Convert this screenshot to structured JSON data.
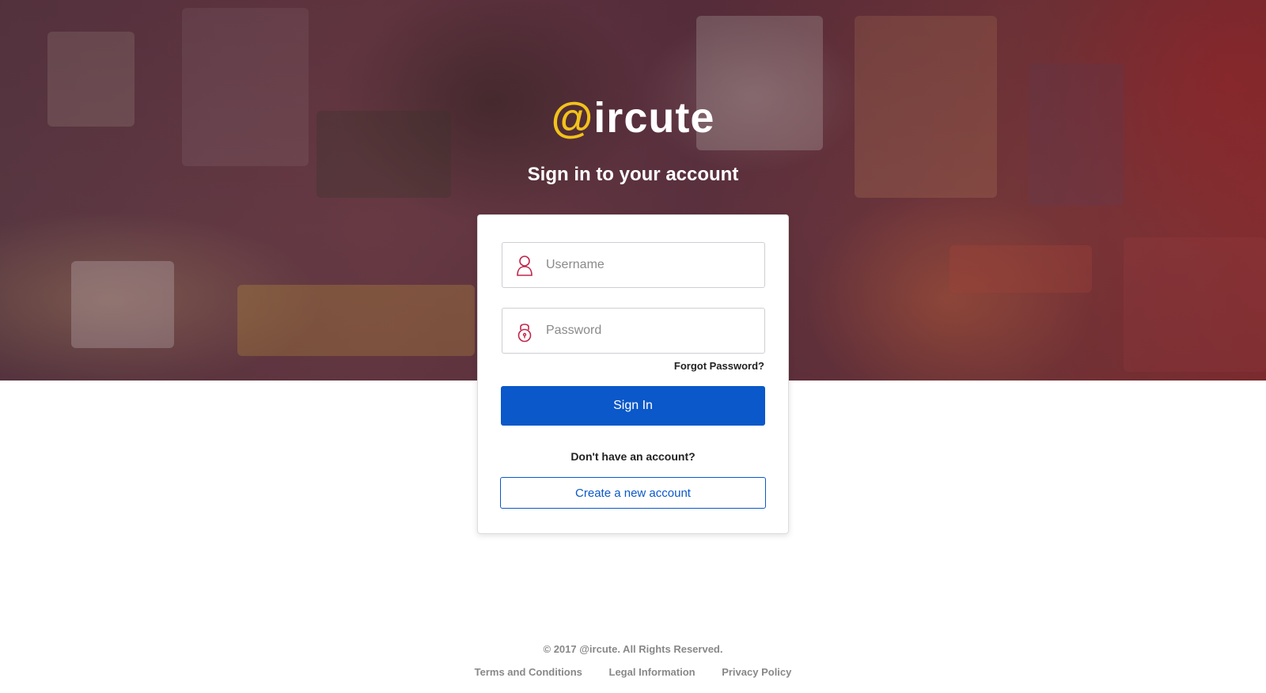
{
  "brand": {
    "logo_at": "@",
    "logo_rest": "ircute",
    "accent_color": "#f2c21b"
  },
  "headline": "Sign in to your account",
  "form": {
    "username_placeholder": "Username",
    "username_icon": "user-icon",
    "password_placeholder": "Password",
    "password_icon": "lock-icon",
    "forgot_password": "Forgot Password?",
    "sign_in": "Sign In",
    "no_account": "Don't have an account?",
    "create_account": "Create a new account",
    "primary_color": "#0a58c9",
    "icon_color": "#c0264a"
  },
  "footer": {
    "copyright": "© 2017 @ircute. All Rights Reserved.",
    "links": [
      "Terms and Conditions",
      "Legal Information",
      "Privacy Policy"
    ]
  }
}
